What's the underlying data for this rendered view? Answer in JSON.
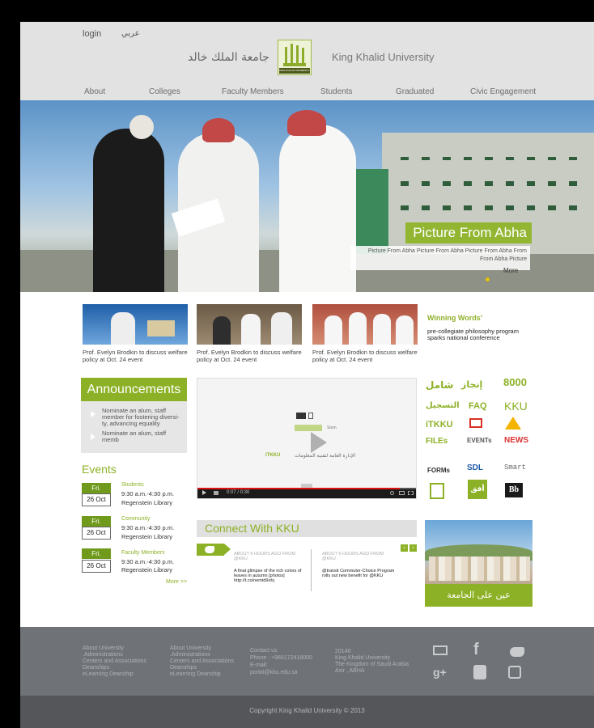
{
  "header": {
    "login_label": "login",
    "arabic_label": "عربي",
    "logo_arabic": "جامعة الملك خالد",
    "logo_english": "King Khalid University",
    "emblem_caption": "KING KHALID UNIVERSITY"
  },
  "nav": {
    "items": [
      "About",
      "Colleges",
      "Faculty Members",
      "Students",
      "Graduated",
      "Civic Engagement"
    ]
  },
  "hero": {
    "title": "Picture From Abha",
    "caption": "Picture From Abha Picture From Abha Picture From Abha From From Abha Picture",
    "more_label": "More"
  },
  "news": {
    "items": [
      {
        "caption": "Prof. Evelyn Brodkin to discuss welfare policy at Oct. 24 event"
      },
      {
        "caption": "Prof. Evelyn Brodkin to discuss welfare policy at Oct. 24 event"
      },
      {
        "caption": "Prof. Evelyn Brodkin to discuss welfare policy at Oct. 24 event"
      }
    ],
    "winning_title": "Winning Words'",
    "winning_text": "pre-collegiate philosophy program sparks national conference"
  },
  "announcements": {
    "title": "Announcements",
    "items": [
      "Nominate an alum, staff member for fostering diversi-ty, advancing equality",
      "Nominate an alum, staff memb"
    ]
  },
  "events": {
    "title": "Events",
    "items": [
      {
        "day": "Fri.",
        "date": "26 Oct",
        "category": "Students",
        "time": "9:30 a.m.-4:30 p.m.",
        "place": "Regenstein Library"
      },
      {
        "day": "Fri.",
        "date": "26 Oct",
        "category": "Community",
        "time": "9:30 a.m.-4:30 p.m.",
        "place": "Regenstein Library"
      },
      {
        "day": "Fri.",
        "date": "26 Oct",
        "category": "Faculty Members",
        "time": "9:30 a.m.-4:30 p.m.",
        "place": "Regenstein Library"
      }
    ],
    "more_label": "More >>"
  },
  "video": {
    "time": "0:07 / 0:30",
    "progress": 0.92,
    "overlay_title": "الإدارة العامة لتقنية المعلومات",
    "overlay_sub": "Soon"
  },
  "services": {
    "items": [
      "شامل",
      "إنجاز",
      "8000",
      "التسجيل",
      "FAQ",
      "KKU",
      "iTKKU",
      "Mail",
      "Drive",
      "FILEs",
      "EVENTs",
      "NEWS",
      "FORMs",
      "SDL",
      "Smart",
      "App",
      "أفق",
      "Bb"
    ]
  },
  "connect": {
    "title": "Connect With KKU",
    "tweets": [
      {
        "meta": "ABOUT 6 HOURS AGO FROM @KKU",
        "text": "A final glimpse of the rich colors of leaves in autumn [photos] http://t.co/nemtd9ohj"
      },
      {
        "meta": "ABOUT 6 HOURS AGO FROM @KKU",
        "text": "@transit Commuter-Choice Program rolls out new benefit for @KKU"
      }
    ]
  },
  "campus": {
    "label": "عين على الجامعة"
  },
  "footer": {
    "col1": [
      "About University",
      ".Administrations",
      "Centers and Associations",
      "Deanships",
      "eLearning Deanship"
    ],
    "col2": [
      "About University",
      ".Administrations",
      "Centers and Associations",
      "Deanships",
      "eLearning Deanship"
    ],
    "contact": [
      "Contact us",
      "Phone : +966172418000",
      "E-mail:",
      "portal@kku.edu.sa"
    ],
    "address": [
      "20140",
      "King Khalid University",
      "The Kingdom of Saudi Arabia",
      "Asir , ABHA"
    ],
    "copyright": "Copyright King Khalid University © 2013"
  },
  "colors": {
    "accent": "#8db126",
    "header_bg": "#e2e2e2",
    "footer_bg": "#6f7377"
  }
}
